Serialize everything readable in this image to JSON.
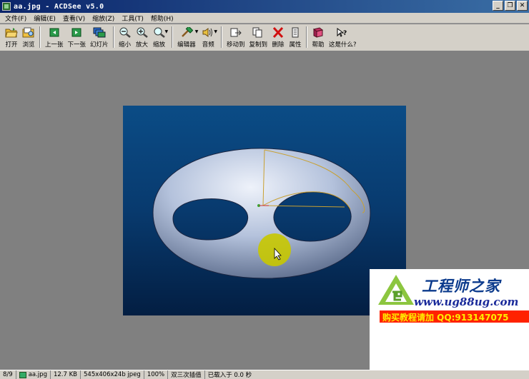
{
  "window": {
    "title": "aa.jpg - ACDSee v5.0",
    "controls": {
      "minimize": "_",
      "restore": "❐",
      "close": "✕"
    }
  },
  "menu": {
    "items": [
      "文件(F)",
      "编辑(E)",
      "查看(V)",
      "缩放(Z)",
      "工具(T)",
      "帮助(H)"
    ]
  },
  "toolbar": {
    "open": "打开",
    "browse": "浏览",
    "prev": "上一张",
    "next": "下一张",
    "slideshow": "幻灯片",
    "zoom_out": "缩小",
    "zoom_in": "放大",
    "zoom": "缩放",
    "editor": "编辑器",
    "audio": "音频",
    "move_to": "移动到",
    "copy_to": "复制到",
    "delete": "删除",
    "properties": "属性",
    "help": "帮助",
    "whats_this": "这是什么?"
  },
  "watermark": {
    "name": "工程师之家",
    "url": "www.ug88ug.com",
    "promo": "购买教程请加 QQ:913147075"
  },
  "status": {
    "index": "8/9",
    "filename": "aa.jpg",
    "filesize": "12.7 KB",
    "dimensions": "545x406x24b jpeg",
    "zoom": "100%",
    "interpolation": "双三次插值",
    "load_time": "已载入于 0.0 秒"
  },
  "colors": {
    "titlebar": "#0a246a",
    "chrome": "#d4d0c8",
    "background": "#808080",
    "photo_top": "#0b4c86",
    "photo_bottom": "#031e42",
    "cursor_highlight": "#c8c800"
  }
}
